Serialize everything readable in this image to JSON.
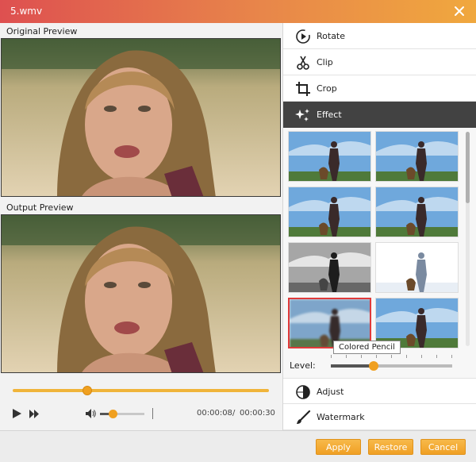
{
  "window": {
    "title": "5.wmv"
  },
  "preview": {
    "original_label": "Original Preview",
    "output_label": "Output Preview"
  },
  "player": {
    "progress": 0.29,
    "volume": 0.28,
    "current_time": "00:00:08",
    "time_separator": "/",
    "total_time": "00:00:30"
  },
  "menu": {
    "rotate": "Rotate",
    "clip": "Clip",
    "crop": "Crop",
    "effect": "Effect",
    "adjust": "Adjust",
    "watermark": "Watermark"
  },
  "effects": {
    "tooltip": "Colored Pencil",
    "level_label": "Level:",
    "level_value": 0.35,
    "selected_index": 6
  },
  "buttons": {
    "apply": "Apply",
    "restore": "Restore",
    "cancel": "Cancel"
  },
  "colors": {
    "accent": "#f0a020",
    "title_start": "#de5050",
    "title_end": "#f0a83e",
    "selected_border": "#e03a3a"
  }
}
